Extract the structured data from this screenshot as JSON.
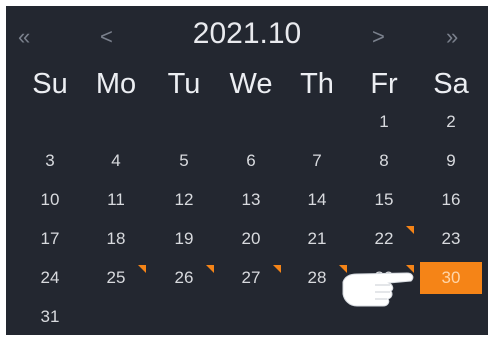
{
  "header": {
    "title": "2021.10",
    "prev_year_icon": "double-chevron-left-icon",
    "prev_month_icon": "chevron-left-icon",
    "next_month_icon": "chevron-right-icon",
    "next_year_icon": "double-chevron-right-icon",
    "prev_year_label": "«",
    "prev_month_label": "<",
    "next_month_label": ">",
    "next_year_label": "»"
  },
  "weekdays": [
    "Su",
    "Mo",
    "Tu",
    "We",
    "Th",
    "Fr",
    "Sa"
  ],
  "days": [
    {
      "label": "1",
      "col": 5,
      "row": 0
    },
    {
      "label": "2",
      "col": 6,
      "row": 0
    },
    {
      "label": "3",
      "col": 0,
      "row": 1
    },
    {
      "label": "4",
      "col": 1,
      "row": 1
    },
    {
      "label": "5",
      "col": 2,
      "row": 1
    },
    {
      "label": "6",
      "col": 3,
      "row": 1
    },
    {
      "label": "7",
      "col": 4,
      "row": 1
    },
    {
      "label": "8",
      "col": 5,
      "row": 1
    },
    {
      "label": "9",
      "col": 6,
      "row": 1
    },
    {
      "label": "10",
      "col": 0,
      "row": 2
    },
    {
      "label": "11",
      "col": 1,
      "row": 2
    },
    {
      "label": "12",
      "col": 2,
      "row": 2
    },
    {
      "label": "13",
      "col": 3,
      "row": 2
    },
    {
      "label": "14",
      "col": 4,
      "row": 2
    },
    {
      "label": "15",
      "col": 5,
      "row": 2
    },
    {
      "label": "16",
      "col": 6,
      "row": 2
    },
    {
      "label": "17",
      "col": 0,
      "row": 3
    },
    {
      "label": "18",
      "col": 1,
      "row": 3
    },
    {
      "label": "19",
      "col": 2,
      "row": 3
    },
    {
      "label": "20",
      "col": 3,
      "row": 3
    },
    {
      "label": "21",
      "col": 4,
      "row": 3
    },
    {
      "label": "22",
      "col": 5,
      "row": 3,
      "marked": true
    },
    {
      "label": "23",
      "col": 6,
      "row": 3
    },
    {
      "label": "24",
      "col": 0,
      "row": 4
    },
    {
      "label": "25",
      "col": 1,
      "row": 4,
      "marked": true
    },
    {
      "label": "26",
      "col": 2,
      "row": 4,
      "marked": true
    },
    {
      "label": "27",
      "col": 3,
      "row": 4,
      "marked": true
    },
    {
      "label": "28",
      "col": 4,
      "row": 4,
      "marked": true
    },
    {
      "label": "29",
      "col": 5,
      "row": 4,
      "marked": true
    },
    {
      "label": "30",
      "col": 6,
      "row": 4,
      "selected": true
    },
    {
      "label": "31",
      "col": 0,
      "row": 5
    }
  ],
  "colors": {
    "background": "#232730",
    "accent": "#f58417",
    "text": "#e9eaee",
    "muted": "#7a808c"
  },
  "cursor_icon": "hand-pointer-icon"
}
